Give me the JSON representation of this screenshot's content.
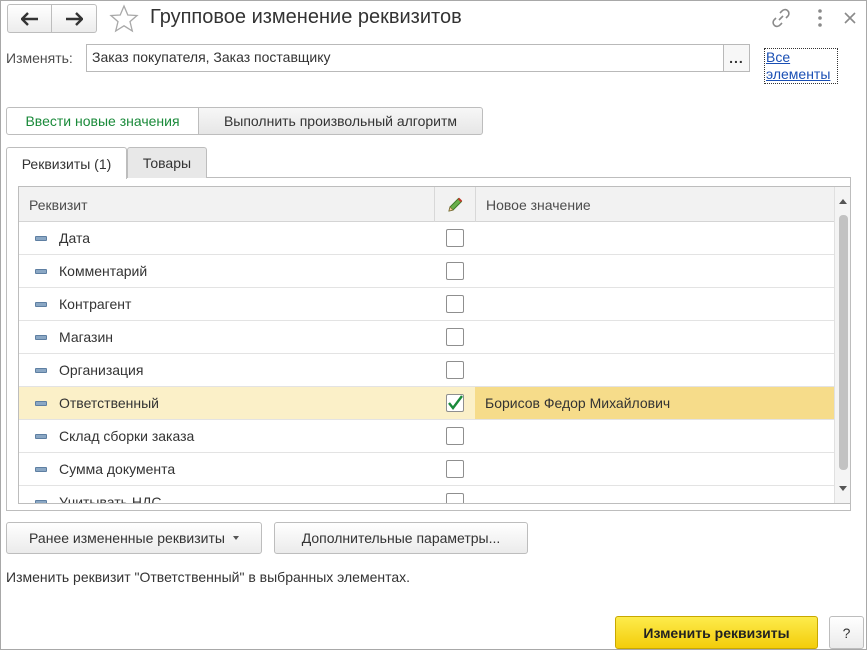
{
  "window": {
    "title": "Групповое изменение реквизитов"
  },
  "change": {
    "label": "Изменять:",
    "value": "Заказ покупателя, Заказ поставщику",
    "select_button": "...",
    "all_link_line1": "Все",
    "all_link_line2": "элементы"
  },
  "modes": {
    "enter_new": "Ввести новые значения",
    "custom_algorithm": "Выполнить произвольный алгоритм"
  },
  "tabs": {
    "requisites": "Реквизиты (1)",
    "goods": "Товары"
  },
  "table": {
    "columns": {
      "attribute": "Реквизит",
      "new_value": "Новое значение"
    },
    "rows": [
      {
        "name": "Дата",
        "checked": false,
        "value": ""
      },
      {
        "name": "Комментарий",
        "checked": false,
        "value": ""
      },
      {
        "name": "Контрагент",
        "checked": false,
        "value": ""
      },
      {
        "name": "Магазин",
        "checked": false,
        "value": ""
      },
      {
        "name": "Организация",
        "checked": false,
        "value": ""
      },
      {
        "name": "Ответственный",
        "checked": true,
        "value": "Борисов Федор Михайлович",
        "selected": true
      },
      {
        "name": "Склад сборки заказа",
        "checked": false,
        "value": ""
      },
      {
        "name": "Сумма документа",
        "checked": false,
        "value": ""
      },
      {
        "name": "Учитывать НДС",
        "checked": false,
        "value": ""
      }
    ]
  },
  "buttons": {
    "previous": "Ранее измененные реквизиты",
    "extra": "Дополнительные параметры...",
    "apply": "Изменить реквизиты",
    "help": "?"
  },
  "status_text": "Изменить реквизит \"Ответственный\" в выбранных элементах.",
  "colors": {
    "accent_green": "#1a8a3a",
    "selected_row": "#fbf0c8",
    "selected_value": "#f6dc8a",
    "apply_button": "#f6d517",
    "link": "#1a4fb4"
  }
}
